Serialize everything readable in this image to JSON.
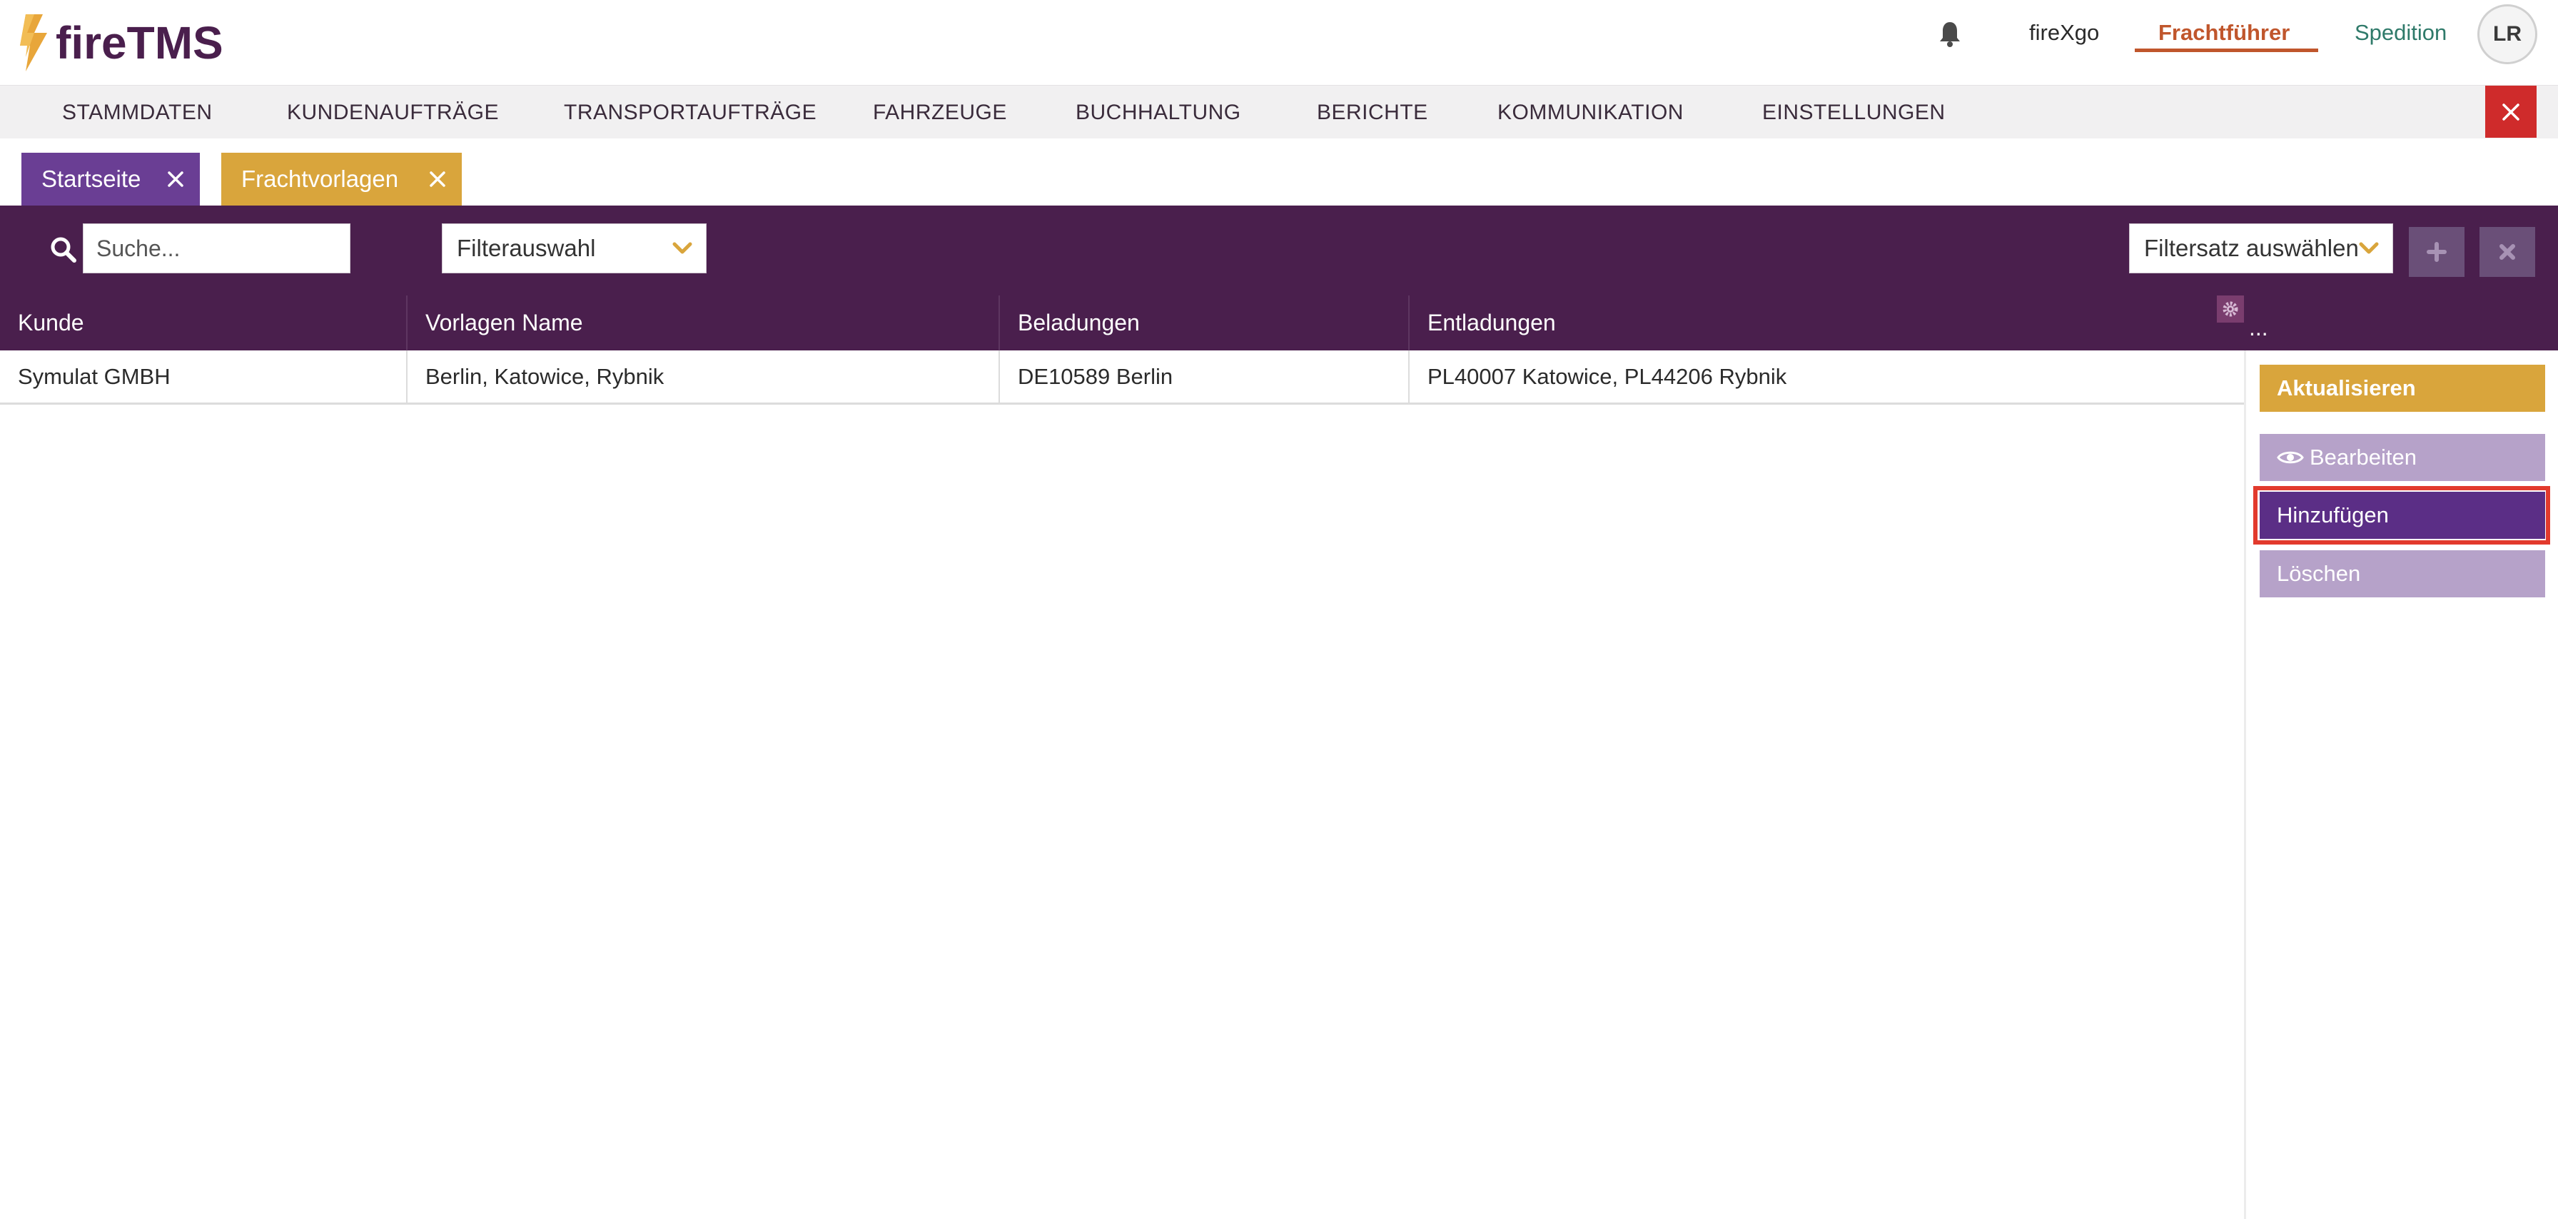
{
  "app": {
    "logo_text": "fireTMS"
  },
  "topbar": {
    "links": {
      "firexgo": "fireXgo",
      "frachtfuehrer": "Frachtführer",
      "spedition": "Spedition"
    },
    "user_initials": "LR"
  },
  "mainnav": {
    "items": [
      "STAMMDATEN",
      "KUNDENAUFTRÄGE",
      "TRANSPORTAUFTRÄGE",
      "FAHRZEUGE",
      "BUCHHALTUNG",
      "BERICHTE",
      "KOMMUNIKATION",
      "EINSTELLUNGEN"
    ]
  },
  "tabs": [
    {
      "label": "Startseite"
    },
    {
      "label": "Frachtvorlagen"
    }
  ],
  "filterbar": {
    "search_placeholder": "Suche...",
    "filter_select": "Filterauswahl",
    "filterset_select": "Filtersatz auswählen"
  },
  "table": {
    "columns": [
      "Kunde",
      "Vorlagen Name",
      "Beladungen",
      "Entladungen",
      "..."
    ],
    "rows": [
      [
        "Symulat GMBH",
        "Berlin, Katowice, Rybnik",
        "DE10589 Berlin",
        "PL40007 Katowice, PL44206 Rybnik"
      ]
    ]
  },
  "actions": {
    "refresh": "Aktualisieren",
    "edit": "Bearbeiten",
    "add": "Hinzufügen",
    "delete": "Löschen"
  },
  "colors": {
    "brand_purple": "#4a1f4d",
    "tab_purple": "#6a3e94",
    "accent_gold": "#d9a53c",
    "active_orange": "#c0562c",
    "close_red": "#cf2b2b",
    "highlight_red": "#e23a2d"
  },
  "icons": [
    "bell-icon",
    "search-icon",
    "chevron-down-icon",
    "plus-icon",
    "close-icon",
    "gear-icon",
    "eye-icon"
  ]
}
